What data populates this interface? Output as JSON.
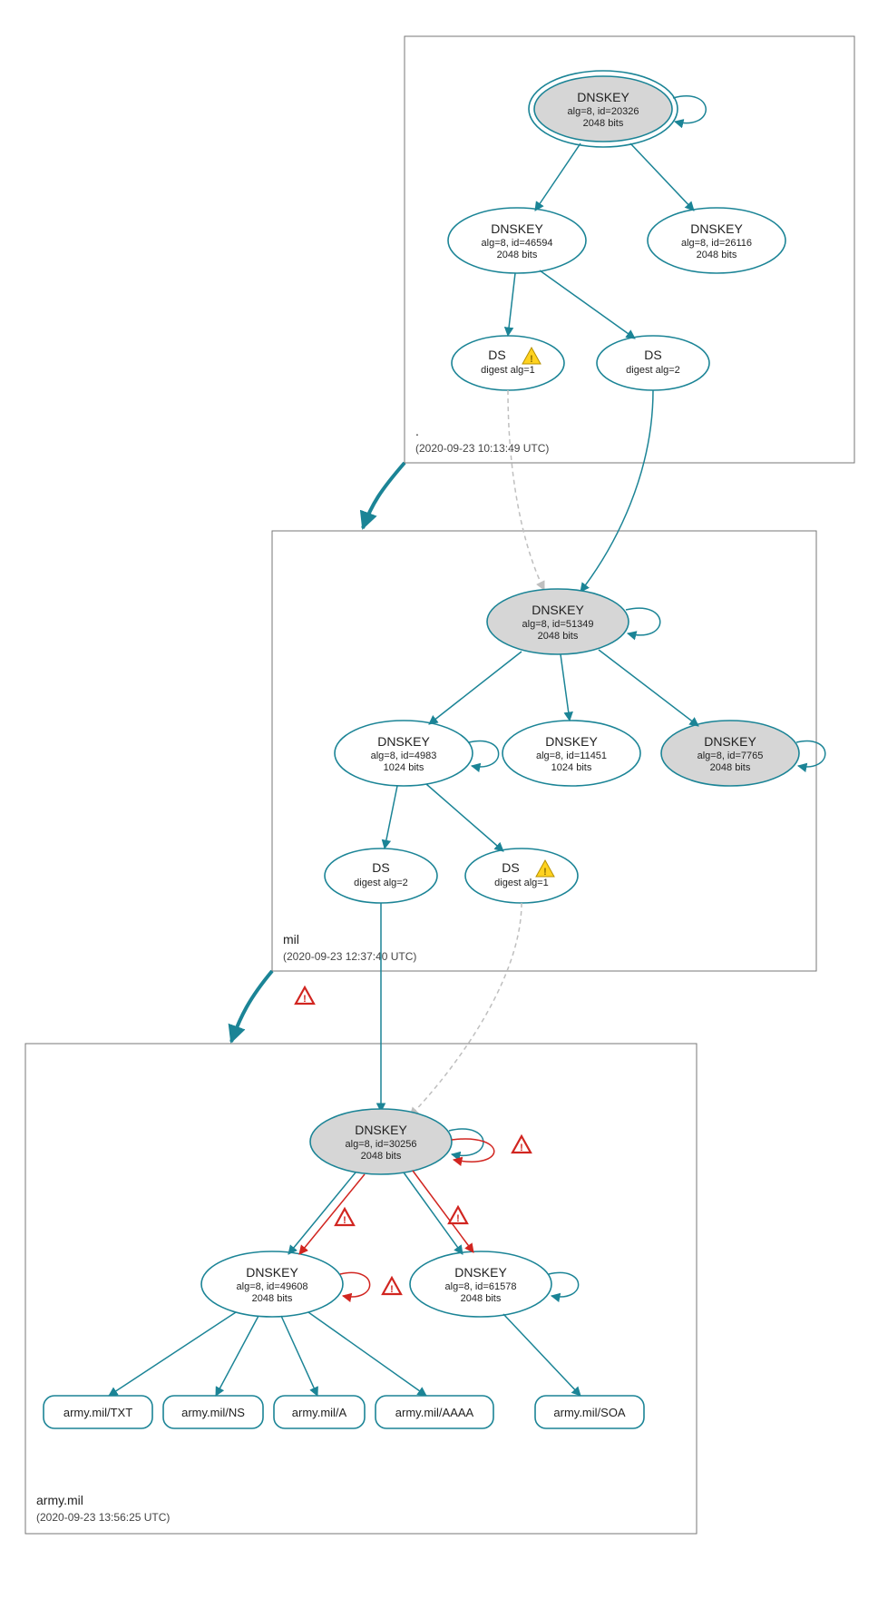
{
  "zones": {
    "root": {
      "label": ".",
      "timestamp": "(2020-09-23 10:13:49 UTC)"
    },
    "mil": {
      "label": "mil",
      "timestamp": "(2020-09-23 12:37:40 UTC)"
    },
    "army": {
      "label": "army.mil",
      "timestamp": "(2020-09-23 13:56:25 UTC)"
    }
  },
  "nodes": {
    "root_ksk": {
      "title": "DNSKEY",
      "line2": "alg=8, id=20326",
      "line3": "2048 bits"
    },
    "root_46594": {
      "title": "DNSKEY",
      "line2": "alg=8, id=46594",
      "line3": "2048 bits"
    },
    "root_26116": {
      "title": "DNSKEY",
      "line2": "alg=8, id=26116",
      "line3": "2048 bits"
    },
    "root_ds1": {
      "title": "DS",
      "line2": "digest alg=1",
      "line3": ""
    },
    "root_ds2": {
      "title": "DS",
      "line2": "digest alg=2",
      "line3": ""
    },
    "mil_ksk": {
      "title": "DNSKEY",
      "line2": "alg=8, id=51349",
      "line3": "2048 bits"
    },
    "mil_4983": {
      "title": "DNSKEY",
      "line2": "alg=8, id=4983",
      "line3": "1024 bits"
    },
    "mil_11451": {
      "title": "DNSKEY",
      "line2": "alg=8, id=11451",
      "line3": "1024 bits"
    },
    "mil_7765": {
      "title": "DNSKEY",
      "line2": "alg=8, id=7765",
      "line3": "2048 bits"
    },
    "mil_ds2": {
      "title": "DS",
      "line2": "digest alg=2",
      "line3": ""
    },
    "mil_ds1": {
      "title": "DS",
      "line2": "digest alg=1",
      "line3": ""
    },
    "army_ksk": {
      "title": "DNSKEY",
      "line2": "alg=8, id=30256",
      "line3": "2048 bits"
    },
    "army_49608": {
      "title": "DNSKEY",
      "line2": "alg=8, id=49608",
      "line3": "2048 bits"
    },
    "army_61578": {
      "title": "DNSKEY",
      "line2": "alg=8, id=61578",
      "line3": "2048 bits"
    }
  },
  "rrsets": {
    "txt": "army.mil/TXT",
    "ns": "army.mil/NS",
    "a": "army.mil/A",
    "aaaa": "army.mil/AAAA",
    "soa": "army.mil/SOA"
  }
}
